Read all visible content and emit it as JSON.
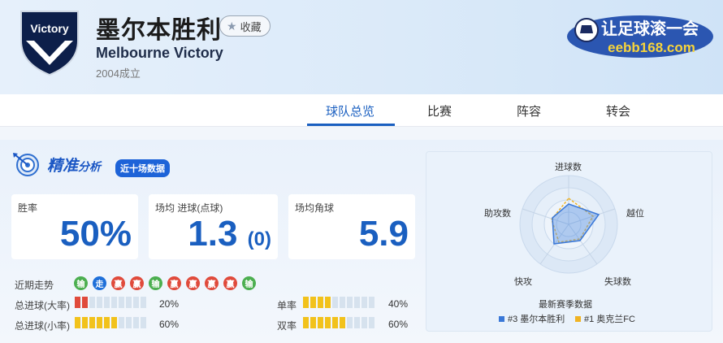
{
  "header": {
    "logo_text": "Victory",
    "team_name": "墨尔本胜利",
    "favorite_label": "收藏",
    "team_name_en": "Melbourne Victory",
    "founded": "2004成立",
    "brand_text": "让足球滚一会",
    "brand_url": "eebb168.com"
  },
  "nav": {
    "tabs": [
      {
        "label": "球队总览",
        "active": true
      },
      {
        "label": "比赛",
        "active": false
      },
      {
        "label": "阵容",
        "active": false
      },
      {
        "label": "转会",
        "active": false
      }
    ]
  },
  "analysis": {
    "title_main": "精准",
    "title_sub": "分析",
    "badge": "近十场数据",
    "stats": [
      {
        "label": "胜率",
        "value": "50%"
      },
      {
        "label": "场均 进球(点球)",
        "value": "1.3",
        "sub": "(0)"
      },
      {
        "label": "场均角球",
        "value": "5.9"
      }
    ],
    "recent_label": "近期走势",
    "recent": [
      {
        "text": "输",
        "result": "win"
      },
      {
        "text": "走",
        "result": "draw"
      },
      {
        "text": "赢",
        "result": "lose"
      },
      {
        "text": "赢",
        "result": "lose"
      },
      {
        "text": "输",
        "result": "win"
      },
      {
        "text": "赢",
        "result": "lose"
      },
      {
        "text": "赢",
        "result": "lose"
      },
      {
        "text": "赢",
        "result": "lose"
      },
      {
        "text": "赢",
        "result": "lose"
      },
      {
        "text": "输",
        "result": "win"
      }
    ],
    "metrics": [
      {
        "label": "总进球(大率)",
        "filled": 2,
        "color": "red",
        "value": "20%"
      },
      {
        "label": "总进球(小率)",
        "filled": 6,
        "color": "yellow",
        "value": "60%"
      },
      {
        "label": "单率",
        "filled": 4,
        "color": "yellow",
        "value": "40%"
      },
      {
        "label": "双率",
        "filled": 6,
        "color": "yellow",
        "value": "60%"
      }
    ]
  },
  "radar": {
    "axes": [
      "进球数",
      "越位",
      "失球数",
      "快攻",
      "助攻数"
    ],
    "caption": "最新赛季数据",
    "legend": [
      {
        "name": "#3 墨尔本胜利",
        "color": "#3a78d8"
      },
      {
        "name": "#1 奥克兰FC",
        "color": "#f0b323"
      }
    ]
  },
  "colors": {
    "accent": "#1a5fc0",
    "win": "#4caf50",
    "draw": "#1e6fd9",
    "lose": "#e04a3b",
    "bar_yellow": "#f2c21b"
  }
}
